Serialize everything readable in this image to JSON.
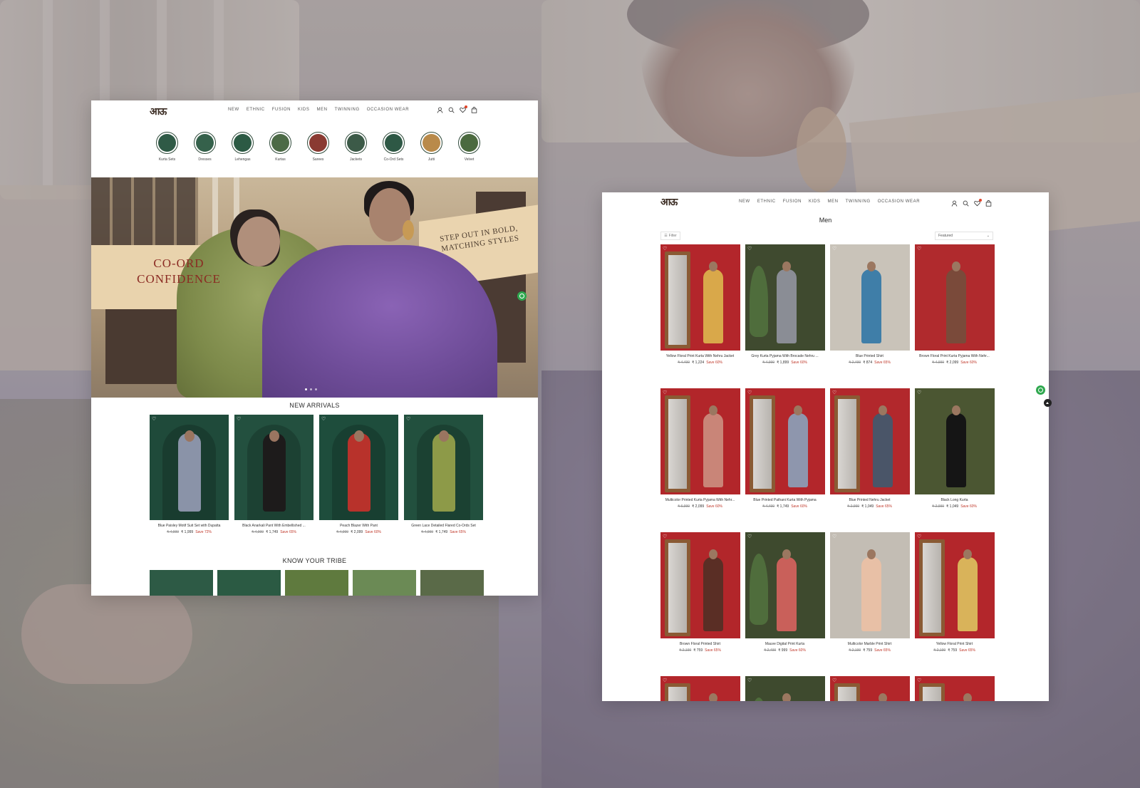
{
  "brand": {
    "logo_text": "आऊ"
  },
  "nav": [
    "NEW",
    "ETHNIC",
    "FUSION",
    "KIDS",
    "MEN",
    "TWINNING",
    "OCCASION WEAR"
  ],
  "home": {
    "categories": [
      {
        "label": "Kurta Sets",
        "color": "#2f5a46"
      },
      {
        "label": "Dresses",
        "color": "#35614b"
      },
      {
        "label": "Lehengas",
        "color": "#2c5a44"
      },
      {
        "label": "Kurtas",
        "color": "#4c6a46"
      },
      {
        "label": "Sarees",
        "color": "#8a3a32"
      },
      {
        "label": "Jackets",
        "color": "#3c5a48"
      },
      {
        "label": "Co-Ord Sets",
        "color": "#2e5845"
      },
      {
        "label": "Jutti",
        "color": "#b98a4a"
      },
      {
        "label": "Velvet",
        "color": "#4b6a3f"
      }
    ],
    "hero": {
      "headline_left": "CO-ORD CONFIDENCE",
      "headline_right": "STEP OUT IN BOLD, MATCHING STYLES"
    },
    "new_arrivals_title": "NEW ARRIVALS",
    "new_arrivals": [
      {
        "name": "Blue Paisley Motif Suit Set with Dupatta",
        "mrp": "₹ 4,999",
        "price": "₹ 1,999",
        "save": "Save 72%",
        "bg": "#1f4a3a",
        "outfit": "#8a93a8"
      },
      {
        "name": "Black Anarkali Pant With Embellished ...",
        "mrp": "₹ 4,999",
        "price": "₹ 1,749",
        "save": "Save 65%",
        "bg": "#23503f",
        "outfit": "#1d1b1b"
      },
      {
        "name": "Peach Blazer With Pant",
        "mrp": "₹ 4,999",
        "price": "₹ 2,099",
        "save": "Save 60%",
        "bg": "#1e4d3c",
        "outfit": "#b8322b"
      },
      {
        "name": "Green Lace Detailed Flared Co-Ords Set",
        "mrp": "₹ 4,999",
        "price": "₹ 1,749",
        "save": "Save 65%",
        "bg": "#22503e",
        "outfit": "#8d9a48"
      }
    ],
    "tribe_title": "KNOW YOUR TRIBE",
    "tribe_colors": [
      "#2d5a45",
      "#2b5a43",
      "#5f7a3e",
      "#6b8a55",
      "#5a6a48"
    ]
  },
  "men": {
    "title": "Men",
    "filter_label": "Filter",
    "sort_value": "Featured",
    "products": [
      {
        "name": "Yellow Floral Print Kurta With Nehru Jacket",
        "mrp": "₹ 4,499",
        "price": "₹ 1,224",
        "save": "Save 60%",
        "bg": "#b3262b",
        "outfit": "#d9a84a",
        "prop": "mirror"
      },
      {
        "name": "Grey Kurta Pyjama With Brocade Nehru ...",
        "mrp": "₹ 4,999",
        "price": "₹ 1,899",
        "save": "Save 60%",
        "bg": "#3f4a2f",
        "outfit": "#8a8d95",
        "prop": "plant"
      },
      {
        "name": "Blue Printed Shirt",
        "mrp": "₹ 2,499",
        "price": "₹ 874",
        "save": "Save 65%",
        "bg": "#c9c3b9",
        "outfit": "#3f7ea8",
        "prop": "none"
      },
      {
        "name": "Brown Floral Print Kurta Pyjama With Nehr...",
        "mrp": "₹ 4,999",
        "price": "₹ 2,099",
        "save": "Save 60%",
        "bg": "#b02a2d",
        "outfit": "#7a4a3a",
        "prop": "none"
      },
      {
        "name": "Multicolor Printed Kurta Pyjama With Nehr...",
        "mrp": "₹ 6,999",
        "price": "₹ 2,099",
        "save": "Save 60%",
        "bg": "#b2262a",
        "outfit": "#c98578",
        "prop": "mirror"
      },
      {
        "name": "Blue Printed Pathani Kurta With Pyjama",
        "mrp": "₹ 4,499",
        "price": "₹ 1,749",
        "save": "Save 60%",
        "bg": "#b3262b",
        "outfit": "#8e96ad",
        "prop": "mirror"
      },
      {
        "name": "Blue Printed Nehru Jacket",
        "mrp": "₹ 2,999",
        "price": "₹ 1,049",
        "save": "Save 65%",
        "bg": "#b2282c",
        "outfit": "#4a5568",
        "prop": "mirror"
      },
      {
        "name": "Black Long Kurta",
        "mrp": "₹ 2,999",
        "price": "₹ 1,049",
        "save": "Save 60%",
        "bg": "#4b5632",
        "outfit": "#151515",
        "prop": "none"
      },
      {
        "name": "Brown Floral Printed Shirt",
        "mrp": "₹ 2,199",
        "price": "₹ 759",
        "save": "Save 65%",
        "bg": "#b2262a",
        "outfit": "#5a2e25",
        "prop": "mirror"
      },
      {
        "name": "Mauve Digital Print Kurta",
        "mrp": "₹ 2,499",
        "price": "₹ 999",
        "save": "Save 60%",
        "bg": "#3e4a2e",
        "outfit": "#c9605a",
        "prop": "plant"
      },
      {
        "name": "Multicolor Marble Print Shirt",
        "mrp": "₹ 2,199",
        "price": "₹ 759",
        "save": "Save 65%",
        "bg": "#c3bdb4",
        "outfit": "#e8c0a6",
        "prop": "none"
      },
      {
        "name": "Yellow Floral Print Shirt",
        "mrp": "₹ 2,199",
        "price": "₹ 759",
        "save": "Save 65%",
        "bg": "#b3262b",
        "outfit": "#d9b35a",
        "prop": "mirror"
      },
      {
        "name": "",
        "mrp": "",
        "price": "",
        "save": "",
        "bg": "#b3262b",
        "outfit": "#9c2f2c",
        "prop": "mirror"
      },
      {
        "name": "",
        "mrp": "",
        "price": "",
        "save": "",
        "bg": "#3e4a2e",
        "outfit": "#5b6a4c",
        "prop": "plant"
      },
      {
        "name": "",
        "mrp": "",
        "price": "",
        "save": "",
        "bg": "#b2262a",
        "outfit": "#e2c3a8",
        "prop": "mirror"
      },
      {
        "name": "",
        "mrp": "",
        "price": "",
        "save": "",
        "bg": "#b3262b",
        "outfit": "#b2453a",
        "prop": "mirror"
      }
    ]
  },
  "icons": [
    "user-icon",
    "search-icon",
    "heart-icon",
    "bag-icon",
    "whatsapp-icon",
    "filter-icon",
    "chevron-down-icon",
    "chevron-up-icon"
  ]
}
